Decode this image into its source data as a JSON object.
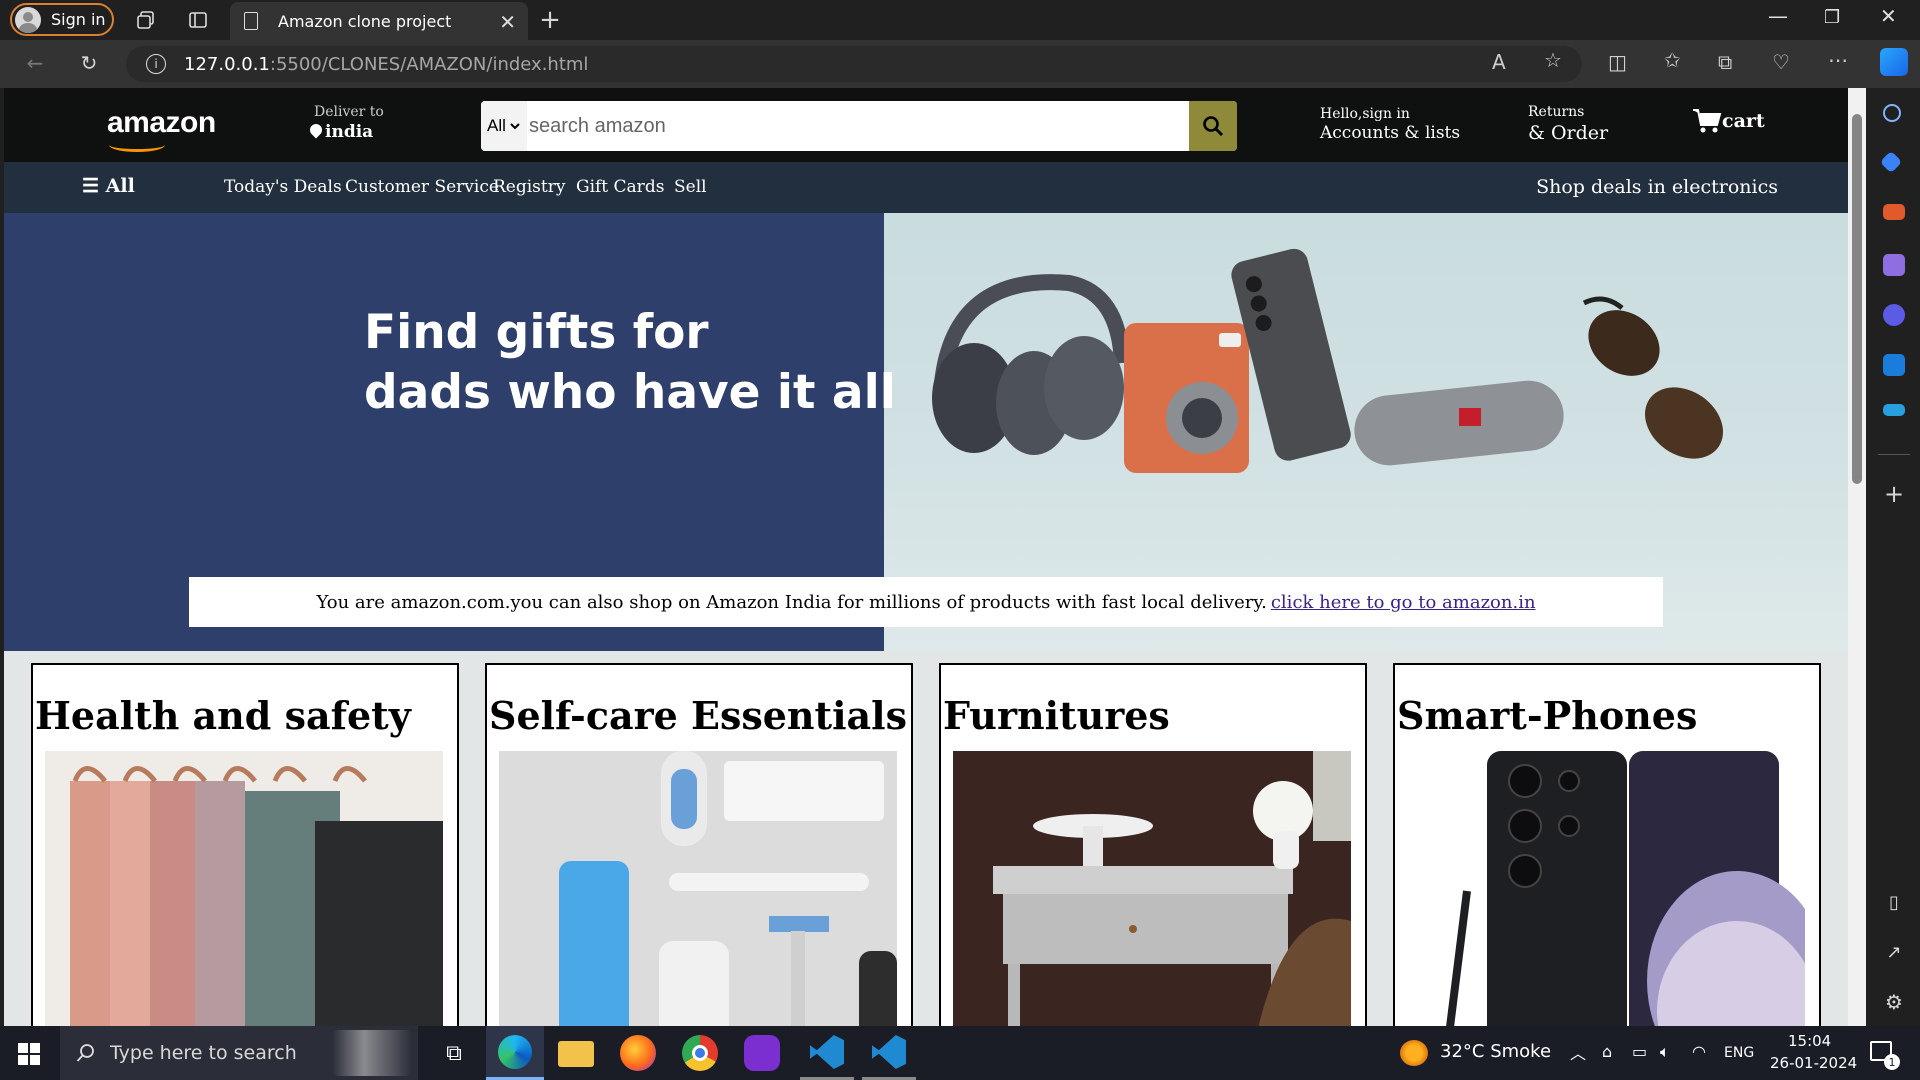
{
  "browser": {
    "signin_label": "Sign in",
    "tab_title": "Amazon clone project",
    "url_host": "127.0.0.1",
    "url_path": ":5500/CLONES/AMAZON/index.html"
  },
  "navbar": {
    "logo": "amazon",
    "deliver_label": "Deliver to",
    "deliver_value": "india",
    "search_category": "All",
    "search_placeholder": "search amazon",
    "account_line1": "Hello,sign in",
    "account_line2": "Accounts & lists",
    "returns_line1": "Returns",
    "returns_line2": "& Order",
    "cart_label": "cart"
  },
  "subnav": {
    "all_label": "All",
    "links": [
      "Today's Deals",
      "Customer Service",
      "Registry",
      "Gift Cards",
      "Sell"
    ],
    "deals_label": "Shop deals in electronics"
  },
  "hero": {
    "title_line1": "Find gifts for",
    "title_line2": "dads who have it all",
    "notice_text": "You are amazon.com.you can also shop on Amazon India for millions of products with fast local delivery.",
    "notice_link": " click here to go to amazon.in"
  },
  "cards": [
    {
      "title": "Health and safety"
    },
    {
      "title": "Self-care Essentials"
    },
    {
      "title": "Furnitures"
    },
    {
      "title": "Smart-Phones"
    }
  ],
  "taskbar": {
    "search_placeholder": "Type here to search",
    "weather": "32°C  Smoke",
    "lang": "ENG",
    "time": "15:04",
    "date": "26-01-2024",
    "notif_count": "1"
  },
  "colors": {
    "nav_bg": "#0f1111",
    "subnav_bg": "#222f3e",
    "hero_left": "#2f3f6b",
    "search_btn": "#8f8a3a",
    "page_bg": "#e3e6e6"
  }
}
